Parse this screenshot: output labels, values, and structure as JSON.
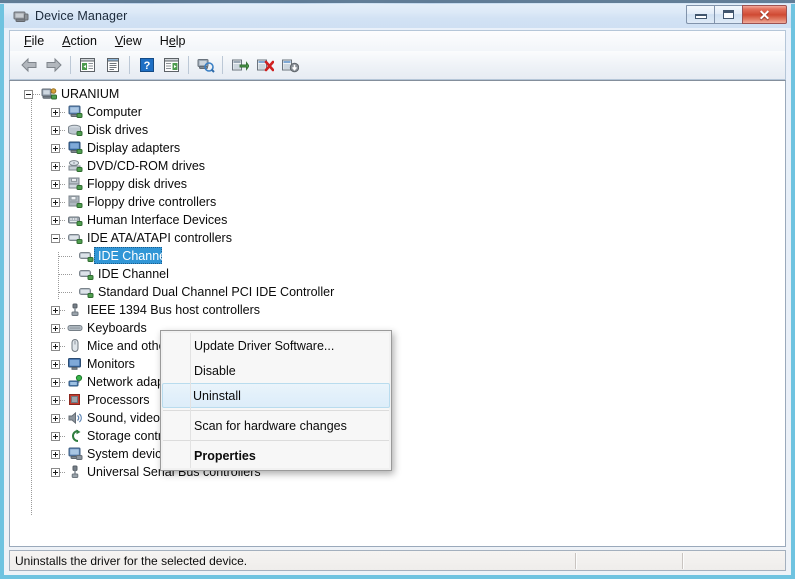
{
  "window": {
    "title": "Device Manager",
    "icon": "device-manager-icon",
    "buttons": {
      "minimize": "minimize-button",
      "maximize": "maximize-button",
      "close": "✕"
    }
  },
  "menubar": {
    "items": [
      {
        "label": "File",
        "accel": "F"
      },
      {
        "label": "Action",
        "accel": "A"
      },
      {
        "label": "View",
        "accel": "V"
      },
      {
        "label": "Help",
        "accel": "H"
      }
    ]
  },
  "toolbar": {
    "buttons": [
      {
        "name": "back-icon",
        "tip": "Back"
      },
      {
        "name": "forward-icon",
        "tip": "Forward"
      },
      {
        "name": "separator-1",
        "tip": ""
      },
      {
        "name": "show-hide-console-tree-icon",
        "tip": "Show/Hide Console Tree"
      },
      {
        "name": "properties-icon",
        "tip": "Properties"
      },
      {
        "name": "separator-2",
        "tip": ""
      },
      {
        "name": "help-icon",
        "tip": "Help"
      },
      {
        "name": "show-hide-action-pane-icon",
        "tip": "Show/Hide Action Pane"
      },
      {
        "name": "separator-3",
        "tip": ""
      },
      {
        "name": "scan-for-hardware-changes-icon",
        "tip": "Scan for hardware changes"
      },
      {
        "name": "separator-4",
        "tip": ""
      },
      {
        "name": "update-driver-software-icon",
        "tip": "Update Driver Software"
      },
      {
        "name": "uninstall-icon",
        "tip": "Uninstall"
      },
      {
        "name": "enable-device-icon",
        "tip": "Enable"
      }
    ]
  },
  "tree": {
    "root": {
      "label": "URANIUM",
      "icon": "computer-root-icon",
      "expanded": true
    },
    "nodes": [
      {
        "label": "Computer",
        "icon": "computer-icon",
        "expandable": true,
        "expanded": false
      },
      {
        "label": "Disk drives",
        "icon": "disk-drive-icon",
        "expandable": true,
        "expanded": false
      },
      {
        "label": "Display adapters",
        "icon": "display-adapter-icon",
        "expandable": true,
        "expanded": false
      },
      {
        "label": "DVD/CD-ROM drives",
        "icon": "dvd-drive-icon",
        "expandable": true,
        "expanded": false
      },
      {
        "label": "Floppy disk drives",
        "icon": "floppy-disk-icon",
        "expandable": true,
        "expanded": false
      },
      {
        "label": "Floppy drive controllers",
        "icon": "floppy-controller-icon",
        "expandable": true,
        "expanded": false
      },
      {
        "label": "Human Interface Devices",
        "icon": "hid-icon",
        "expandable": true,
        "expanded": false
      },
      {
        "label": "IDE ATA/ATAPI controllers",
        "icon": "ide-controller-icon",
        "expandable": true,
        "expanded": true,
        "children": [
          {
            "label": "IDE Channel",
            "icon": "ide-channel-icon",
            "selected": true
          },
          {
            "label": "IDE Channel",
            "icon": "ide-channel-icon",
            "selected": false
          },
          {
            "label": "Standard Dual Channel PCI IDE Controller",
            "icon": "ide-channel-icon",
            "selected": false
          }
        ]
      },
      {
        "label": "IEEE 1394 Bus host controllers",
        "icon": "ieee1394-icon",
        "expandable": true,
        "expanded": false
      },
      {
        "label": "Keyboards",
        "icon": "keyboard-icon",
        "expandable": true,
        "expanded": false
      },
      {
        "label": "Mice and other pointing devices",
        "icon": "mouse-icon",
        "expandable": true,
        "expanded": false
      },
      {
        "label": "Monitors",
        "icon": "monitor-icon",
        "expandable": true,
        "expanded": false
      },
      {
        "label": "Network adapters",
        "icon": "network-adapter-icon",
        "expandable": true,
        "expanded": false
      },
      {
        "label": "Processors",
        "icon": "processor-icon",
        "expandable": true,
        "expanded": false
      },
      {
        "label": "Sound, video and game controllers",
        "icon": "sound-controller-icon",
        "expandable": true,
        "expanded": false
      },
      {
        "label": "Storage controllers",
        "icon": "storage-controller-icon",
        "expandable": true,
        "expanded": false
      },
      {
        "label": "System devices",
        "icon": "system-device-icon",
        "expandable": true,
        "expanded": false
      },
      {
        "label": "Universal Serial Bus controllers",
        "icon": "usb-controller-icon",
        "expandable": true,
        "expanded": false
      }
    ]
  },
  "context_menu": {
    "items": [
      {
        "label": "Update Driver Software...",
        "highlighted": false,
        "bold": false
      },
      {
        "label": "Disable",
        "highlighted": false,
        "bold": false
      },
      {
        "label": "Uninstall",
        "highlighted": true,
        "bold": false
      },
      {
        "separator": true
      },
      {
        "label": "Scan for hardware changes",
        "highlighted": false,
        "bold": false
      },
      {
        "separator": true
      },
      {
        "label": "Properties",
        "highlighted": false,
        "bold": true
      }
    ]
  },
  "statusbar": {
    "text": "Uninstalls the driver for the selected device."
  },
  "colors": {
    "selection_blue": "#3196d6",
    "highlight_blue": "#e2f0fa",
    "frame_cyan": "#6fc3e0",
    "close_red": "#cf4a33",
    "help_blue": "#1e6fc4"
  }
}
